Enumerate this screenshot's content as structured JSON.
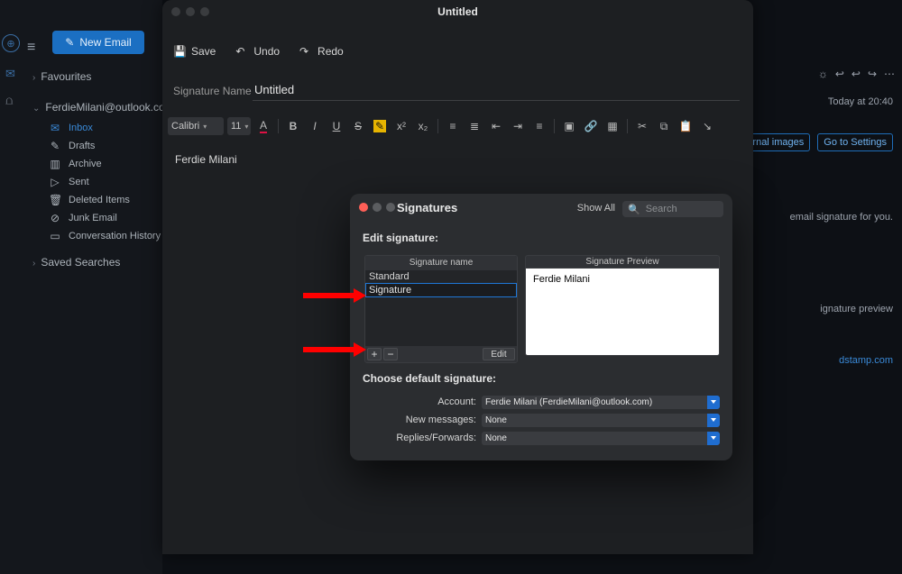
{
  "leftbar": {
    "new_email": "New Email",
    "favourites": "Favourites",
    "account": "FerdieMilani@outlook.co",
    "folders": [
      {
        "icon": "inbox",
        "label": "Inbox",
        "active": true
      },
      {
        "icon": "draft",
        "label": "Drafts"
      },
      {
        "icon": "archive",
        "label": "Archive"
      },
      {
        "icon": "sent",
        "label": "Sent"
      },
      {
        "icon": "trash",
        "label": "Deleted Items"
      },
      {
        "icon": "junk",
        "label": "Junk Email"
      },
      {
        "icon": "history",
        "label": "Conversation History"
      }
    ],
    "saved": "Saved Searches"
  },
  "bg": {
    "time": "Today at 20:40",
    "pill1": "ad external images",
    "pill2": "Go to Settings",
    "line1": "email signature for you.",
    "line2": "ignature preview",
    "link": "dstamp.com"
  },
  "editor": {
    "title": "Untitled",
    "save": "Save",
    "undo": "Undo",
    "redo": "Redo",
    "sig_name_label": "Signature Name",
    "sig_name_value": "Untitled",
    "font_label": "Calibri",
    "font_size": "11",
    "body": "Ferdie Milani"
  },
  "modal": {
    "title": "Signatures",
    "show_all": "Show All",
    "search_ph": "Search",
    "edit_label": "Edit signature:",
    "list_header": "Signature name",
    "rows": [
      "Standard"
    ],
    "editing": "Signature",
    "edit_btn": "Edit",
    "preview_header": "Signature Preview",
    "preview_body": "Ferdie Milani",
    "defaults_label": "Choose default signature:",
    "account_lbl": "Account:",
    "account_val": "Ferdie Milani (FerdieMilani@outlook.com)",
    "newmsg_lbl": "New messages:",
    "newmsg_val": "None",
    "replies_lbl": "Replies/Forwards:",
    "replies_val": "None"
  }
}
